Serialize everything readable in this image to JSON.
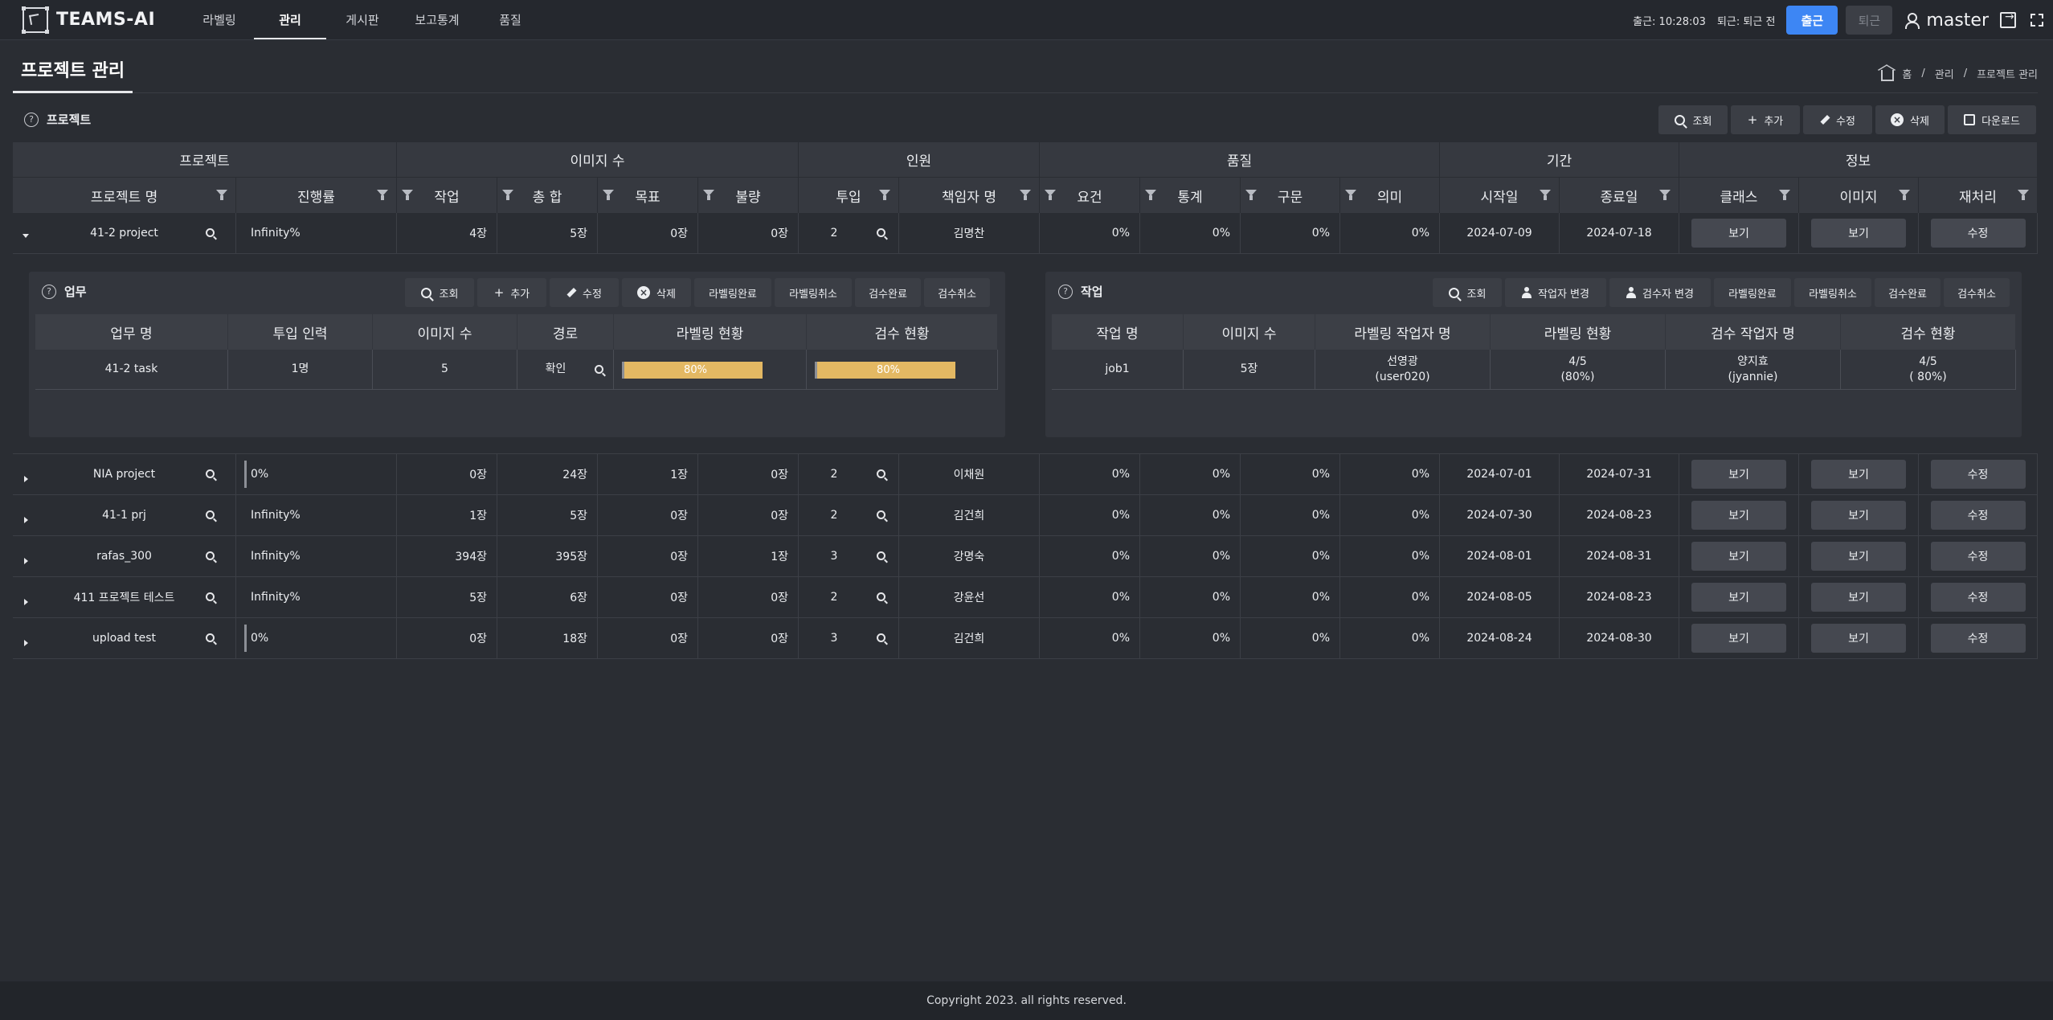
{
  "app": {
    "title": "TEAMS-AI"
  },
  "nav": [
    "라벨링",
    "관리",
    "게시판",
    "보고통계",
    "품질"
  ],
  "nav_active": 1,
  "top": {
    "checkin": "출근: 10:28:03",
    "checkout": "퇴근: 퇴근 전",
    "btn_in": "출근",
    "btn_out": "퇴근",
    "user": "master"
  },
  "page": {
    "title": "프로젝트 관리",
    "breadcrumb": [
      "홈",
      "관리",
      "프로젝트 관리"
    ]
  },
  "project_section": {
    "title": "프로젝트",
    "toolbar": [
      "조회",
      "추가",
      "수정",
      "삭제",
      "다운로드"
    ],
    "groups": [
      "프로젝트",
      "이미지 수",
      "인원",
      "품질",
      "기간",
      "정보"
    ],
    "columns": [
      "프로젝트 명",
      "진행률",
      "작업",
      "총 합",
      "목표",
      "불량",
      "투입",
      "책임자 명",
      "요건",
      "통계",
      "구문",
      "의미",
      "시작일",
      "종료일",
      "클래스",
      "이미지",
      "재처리"
    ],
    "row_buttons": [
      "보기",
      "보기",
      "수정"
    ],
    "rows": [
      {
        "name": "41-2 project",
        "progress": "Infinity%",
        "work": "4장",
        "total": "5장",
        "target": "0장",
        "defect": "0장",
        "staff": "2",
        "manager": "김명찬",
        "req": "0%",
        "stat": "0%",
        "syntax": "0%",
        "meaning": "0%",
        "start": "2024-07-09",
        "end": "2024-07-18"
      },
      {
        "name": "NIA project",
        "progress": "0%",
        "work": "0장",
        "total": "24장",
        "target": "1장",
        "defect": "0장",
        "staff": "2",
        "manager": "이채원",
        "req": "0%",
        "stat": "0%",
        "syntax": "0%",
        "meaning": "0%",
        "start": "2024-07-01",
        "end": "2024-07-31"
      },
      {
        "name": "41-1 prj",
        "progress": "Infinity%",
        "work": "1장",
        "total": "5장",
        "target": "0장",
        "defect": "0장",
        "staff": "2",
        "manager": "김건희",
        "req": "0%",
        "stat": "0%",
        "syntax": "0%",
        "meaning": "0%",
        "start": "2024-07-30",
        "end": "2024-08-23"
      },
      {
        "name": "rafas_300",
        "progress": "Infinity%",
        "work": "394장",
        "total": "395장",
        "target": "0장",
        "defect": "1장",
        "staff": "3",
        "manager": "강명숙",
        "req": "0%",
        "stat": "0%",
        "syntax": "0%",
        "meaning": "0%",
        "start": "2024-08-01",
        "end": "2024-08-31"
      },
      {
        "name": "411 프로젝트 테스트",
        "progress": "Infinity%",
        "work": "5장",
        "total": "6장",
        "target": "0장",
        "defect": "0장",
        "staff": "2",
        "manager": "강윤선",
        "req": "0%",
        "stat": "0%",
        "syntax": "0%",
        "meaning": "0%",
        "start": "2024-08-05",
        "end": "2024-08-23"
      },
      {
        "name": "upload test",
        "progress": "0%",
        "work": "0장",
        "total": "18장",
        "target": "0장",
        "defect": "0장",
        "staff": "3",
        "manager": "김건희",
        "req": "0%",
        "stat": "0%",
        "syntax": "0%",
        "meaning": "0%",
        "start": "2024-08-24",
        "end": "2024-08-30"
      }
    ]
  },
  "task_panel": {
    "title": "업무",
    "toolbar": [
      "조회",
      "추가",
      "수정",
      "삭제",
      "라벨링완료",
      "라벨링취소",
      "검수완료",
      "검수취소"
    ],
    "columns": [
      "업무 명",
      "투입 인력",
      "이미지 수",
      "경로",
      "라벨링 현황",
      "검수 현황"
    ],
    "row": {
      "name": "41-2 task",
      "staff": "1명",
      "images": "5",
      "path": "확인",
      "labeling": "80%",
      "labeling_value": 80,
      "review": "80%",
      "review_value": 80
    }
  },
  "job_panel": {
    "title": "작업",
    "toolbar": [
      "조회",
      "작업자 변경",
      "검수자 변경",
      "라벨링완료",
      "라벨링취소",
      "검수완료",
      "검수취소"
    ],
    "columns": [
      "작업 명",
      "이미지 수",
      "라벨링 작업자 명",
      "라벨링 현황",
      "검수 작업자 명",
      "검수 현황"
    ],
    "row": {
      "name": "job1",
      "images": "5장",
      "labeler": "선영광",
      "labeler_id": "(user020)",
      "labeling": "4/5",
      "labeling_pct": "(80%)",
      "reviewer": "양지효",
      "reviewer_id": "(jyannie)",
      "review": "4/5",
      "review_pct": "( 80%)"
    }
  },
  "footer": "Copyright 2023. all rights reserved.",
  "colors": {
    "accent": "#3d86f4",
    "progress_bar": "#e3b863",
    "background": "#2a2d33"
  }
}
